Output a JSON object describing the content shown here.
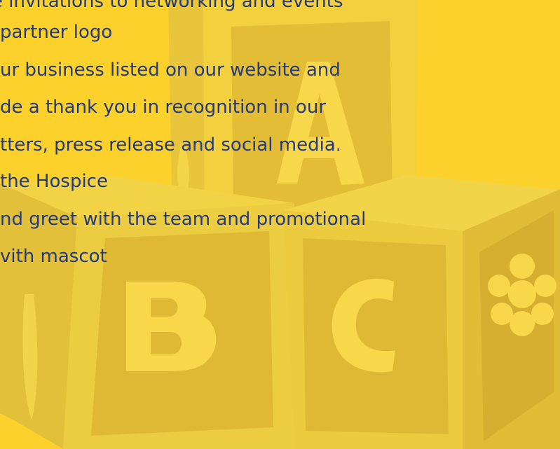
{
  "colors": {
    "background": "#fcd12c",
    "text": "#253a7a",
    "block_light": "#f5d64a",
    "block_mid": "#e6c23a",
    "block_dark": "#d9b030",
    "letter": "#fbd944"
  },
  "content": {
    "lines": [
      "e invitations to networking and events",
      "partner logo",
      "ur business listed on our website and",
      "de a thank you in recognition in our",
      "tters, press release and social media.",
      " the Hospice",
      "nd greet with the team and promotional",
      "vith mascot"
    ]
  },
  "illustration": {
    "blocks": [
      {
        "letter": "A"
      },
      {
        "letter": "B"
      },
      {
        "letter": "C"
      }
    ]
  }
}
